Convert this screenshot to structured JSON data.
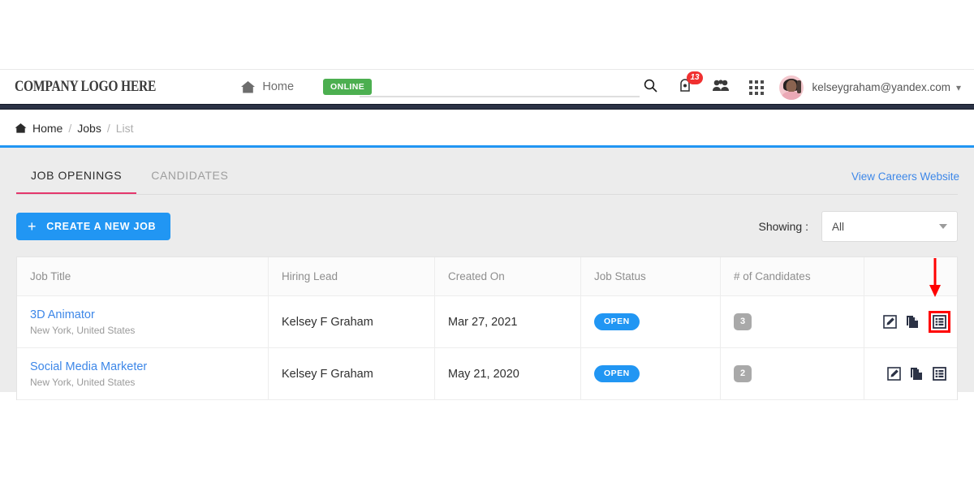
{
  "header": {
    "logo_text": "COMPANY LOGO HERE",
    "nav_home_label": "Home",
    "home_icon": "home-icon",
    "status_badge": "ONLINE",
    "search_placeholder": "",
    "search_value": "",
    "search_icon": "search-icon",
    "notifications_icon": "notification-bell-icon",
    "notifications_count": "13",
    "people_icon": "people-icon",
    "apps_icon": "apps-grid-icon",
    "avatar_icon": "user-avatar",
    "user_email": "kelseygraham@yandex.com",
    "caret_icon": "chevron-down-icon"
  },
  "breadcrumb": {
    "home_icon": "home-icon",
    "items": [
      {
        "label": "Home",
        "current": false
      },
      {
        "label": "Jobs",
        "current": false
      },
      {
        "label": "List",
        "current": true
      }
    ],
    "separator": "/"
  },
  "tabs": [
    {
      "label": "JOB OPENINGS",
      "active": true
    },
    {
      "label": "CANDIDATES",
      "active": false
    }
  ],
  "careers_link": "View Careers Website",
  "toolbar": {
    "create_label": "CREATE A NEW JOB",
    "plus_icon": "plus-icon",
    "showing_label": "Showing :",
    "showing_value": "All",
    "showing_caret": "caret-down-icon"
  },
  "table": {
    "columns": [
      "Job Title",
      "Hiring Lead",
      "Created On",
      "Job Status",
      "# of Candidates",
      ""
    ],
    "rows": [
      {
        "title": "3D Animator",
        "location": "New York, United States",
        "hiring_lead": "Kelsey F Graham",
        "created_on": "Mar 27, 2021",
        "status": "OPEN",
        "candidates": "3",
        "actions": [
          "edit-icon",
          "duplicate-icon",
          "list-view-icon"
        ],
        "highlighted_action": "list-view-icon"
      },
      {
        "title": "Social Media Marketer",
        "location": "New York, United States",
        "hiring_lead": "Kelsey F Graham",
        "created_on": "May 21, 2020",
        "status": "OPEN",
        "candidates": "2",
        "actions": [
          "edit-icon",
          "duplicate-icon",
          "list-view-icon"
        ],
        "highlighted_action": null
      }
    ]
  },
  "annotation": {
    "arrow_icon": "red-down-arrow",
    "arrow_color": "#ff0000",
    "highlight_color": "#ff0000"
  },
  "colors": {
    "accent_blue": "#2196f3",
    "link_blue": "#3d87e8",
    "tab_underline": "#e4376c",
    "online_green": "#4caf50",
    "badge_red": "#f03030",
    "navy": "#2b3245",
    "content_bg": "#ececec"
  }
}
